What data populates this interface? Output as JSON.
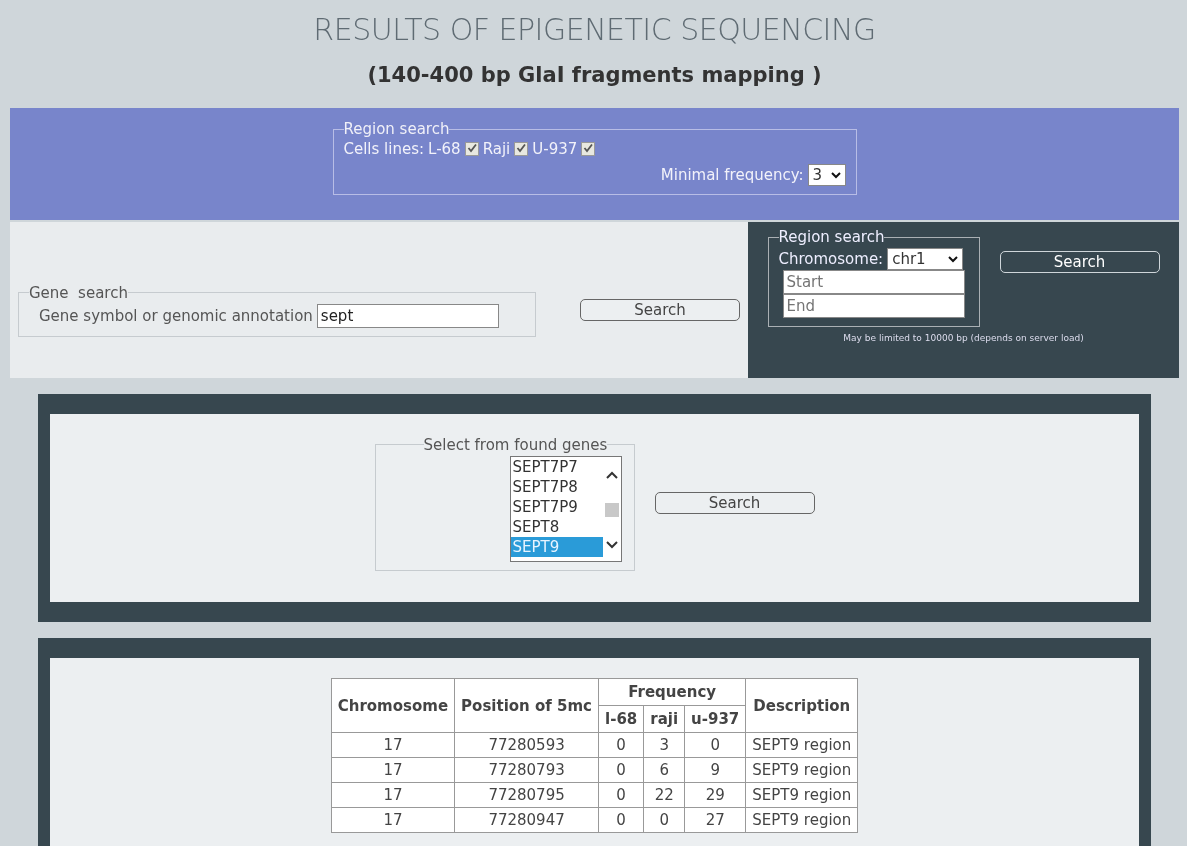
{
  "header": {
    "title": "RESULTS OF EPIGENETIC SEQUENCING",
    "subtitle": "(140-400 bp GlaI fragments mapping )"
  },
  "filter": {
    "legend": "Region search",
    "cells_label": "Cells lines:",
    "cell_lines": [
      {
        "label": "L-68",
        "checked": true
      },
      {
        "label": "Raji",
        "checked": true
      },
      {
        "label": "U-937",
        "checked": true
      }
    ],
    "frequency_label": "Minimal frequency:",
    "frequency_value": "3"
  },
  "gene_search": {
    "legend": "Gene  search",
    "label": "Gene symbol or genomic annotation",
    "value": "sept",
    "button": "Search"
  },
  "region_search": {
    "legend": "Region search",
    "chromosome_label": "Chromosome:",
    "chromosome_value": "chr1",
    "start_placeholder": "Start",
    "end_placeholder": "End",
    "button": "Search",
    "note": "May be limited to 10000 bp (depends on server load)"
  },
  "found_genes": {
    "legend": "Select from found genes",
    "items": [
      {
        "label": "SEPT7P7",
        "selected": false
      },
      {
        "label": "SEPT7P8",
        "selected": false
      },
      {
        "label": "SEPT7P9",
        "selected": false
      },
      {
        "label": "SEPT8",
        "selected": false
      },
      {
        "label": "SEPT9",
        "selected": true
      }
    ],
    "button": "Search"
  },
  "table": {
    "header_rows": [
      [
        {
          "label": "Chromosome",
          "rowspan": 2
        },
        {
          "label": "Position of 5mc",
          "rowspan": 2
        },
        {
          "label": "Frequency",
          "colspan": 3
        },
        {
          "label": "Description",
          "rowspan": 2
        }
      ],
      [
        {
          "label": "l-68"
        },
        {
          "label": "raji"
        },
        {
          "label": "u-937"
        }
      ]
    ],
    "rows": [
      [
        "17",
        "77280593",
        "0",
        "3",
        "0",
        "SEPT9 region"
      ],
      [
        "17",
        "77280793",
        "0",
        "6",
        "9",
        "SEPT9 region"
      ],
      [
        "17",
        "77280795",
        "0",
        "22",
        "29",
        "SEPT9 region"
      ],
      [
        "17",
        "77280947",
        "0",
        "0",
        "27",
        "SEPT9 region"
      ]
    ]
  }
}
